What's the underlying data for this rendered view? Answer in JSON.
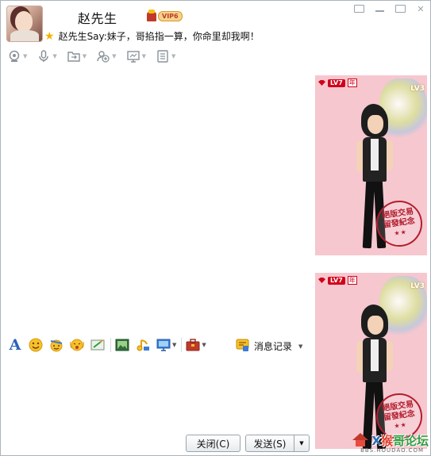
{
  "header": {
    "contact_name": "赵先生",
    "vip_badge": "VIP6",
    "signature": "赵先生Say:妹子，哥掐指一算，你命里却我啊！"
  },
  "window_controls": [
    "restore-icon",
    "minimize-icon",
    "maximize-icon",
    "close-icon"
  ],
  "top_toolbar": {
    "items": [
      "video-call-icon",
      "voice-call-icon",
      "file-transfer-icon",
      "add-member-icon",
      "remote-desktop-icon",
      "app-menu-icon"
    ]
  },
  "show_panel": {
    "level_tag": "LV7",
    "year_tag": "年",
    "level_right": "LV3",
    "stamp_line1": "絕版交易",
    "stamp_line2": "留發紀念"
  },
  "input_toolbar": {
    "items": [
      "font-icon",
      "emoji-icon",
      "magic-emoji-icon",
      "shake-icon",
      "screenshot-icon",
      "image-icon",
      "music-icon",
      "screen-capture-menu-icon",
      "toolbox-icon"
    ],
    "history_label": "消息记录"
  },
  "buttons": {
    "close_label": "关闭(C)",
    "send_label": "发送(S)"
  },
  "watermark": {
    "text_x": "X",
    "text_main": "猴",
    "text_rest": "哥论坛",
    "sub": "BBS.HOUDAO.COM"
  },
  "colors": {
    "panel_bg": "#f6c7cf",
    "accent_red": "#d0021b"
  }
}
